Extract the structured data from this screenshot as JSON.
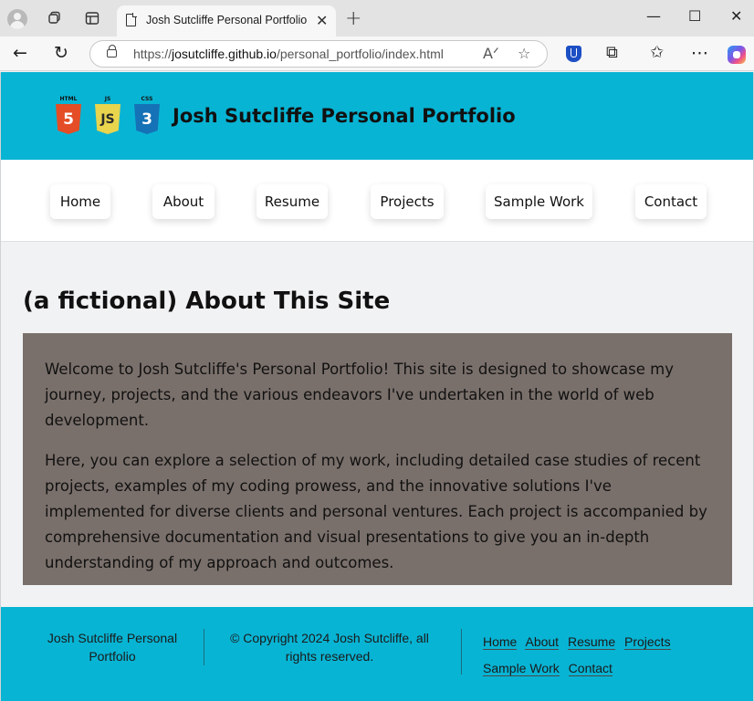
{
  "browser": {
    "tab_title": "Josh Sutcliffe Personal Portfolio",
    "url_prefix": "https://",
    "url_host": "josutcliffe.github.io",
    "url_path": "/personal_portfolio/index.html",
    "icons": {
      "profile": "profile-icon",
      "workspaces": "workspaces-icon",
      "tab_actions": "tab-actions-icon",
      "back": "back-arrow-icon",
      "refresh": "refresh-icon",
      "read_aloud": "read-aloud-icon",
      "favorite": "star-icon",
      "extensions": "puzzle-icon",
      "favorites": "favorites-icon",
      "more": "more-icon",
      "copilot": "copilot-icon"
    }
  },
  "header": {
    "title": "Josh Sutcliffe Personal Portfolio",
    "logos": [
      {
        "label": "HTML",
        "glyph": "5",
        "color": "#e44d26"
      },
      {
        "label": "JS",
        "glyph": "JS",
        "color": "#e8d44d"
      },
      {
        "label": "CSS",
        "glyph": "3",
        "color": "#1572b6"
      }
    ],
    "color": "#08b4d4"
  },
  "nav": {
    "items": [
      {
        "label": "Home"
      },
      {
        "label": "About"
      },
      {
        "label": "Resume"
      },
      {
        "label": "Projects"
      },
      {
        "label": "Sample Work"
      },
      {
        "label": "Contact"
      }
    ]
  },
  "main": {
    "heading": "(a fictional) About This Site",
    "paragraphs": [
      "Welcome to Josh Sutcliffe's Personal Portfolio! This site is designed to showcase my journey, projects, and the various endeavors I've undertaken in the world of web development.",
      "Here, you can explore a selection of my work, including detailed case studies of recent projects, examples of my coding prowess, and the innovative solutions I've implemented for diverse clients and personal ventures. Each project is accompanied by comprehensive documentation and visual presentations to give you an in-depth understanding of my approach and outcomes."
    ],
    "box_color": "#7a706b"
  },
  "footer": {
    "brand": "Josh Sutcliffe Personal Portfolio",
    "copyright": "© Copyright 2024 Josh Sutcliffe, all rights reserved.",
    "links": [
      "Home",
      "About",
      "Resume",
      "Projects",
      "Sample Work",
      "Contact"
    ]
  }
}
